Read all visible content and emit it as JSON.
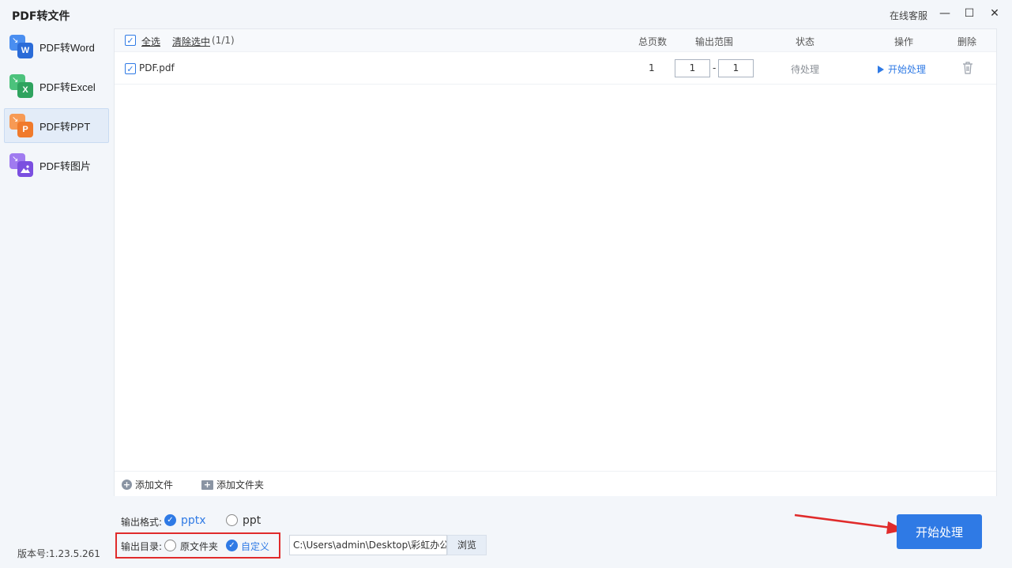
{
  "window": {
    "title": "PDF转文件",
    "service_label": "在线客服",
    "minimize_glyph": "—",
    "maximize_glyph": "☐",
    "close_glyph": "✕"
  },
  "sidebar": {
    "items": [
      {
        "label": "PDF转Word",
        "letter": "W",
        "color": "#2b6cd8",
        "icon": "word-icon",
        "active": false
      },
      {
        "label": "PDF转Excel",
        "letter": "X",
        "color": "#2fa35f",
        "icon": "excel-icon",
        "active": false
      },
      {
        "label": "PDF转PPT",
        "letter": "P",
        "color": "#f07a2b",
        "icon": "ppt-icon",
        "active": true
      },
      {
        "label": "PDF转图片",
        "letter": "",
        "color": "#7b4fe0",
        "icon": "image-icon",
        "active": false
      }
    ],
    "version": "版本号:1.23.5.261"
  },
  "table": {
    "select_all": "全选",
    "clear_selection": "清除选中",
    "selection_count": "(1/1)",
    "columns": {
      "pages": "总页数",
      "range": "输出范围",
      "status": "状态",
      "action": "操作",
      "delete": "删除"
    },
    "rows": [
      {
        "name": "PDF.pdf",
        "pages": "1",
        "range_from": "1",
        "range_sep": "-",
        "range_to": "1",
        "status": "待处理",
        "action": "开始处理",
        "checked": true
      }
    ],
    "add_file": "添加文件",
    "add_folder": "添加文件夹"
  },
  "output": {
    "format_label": "输出格式:",
    "format_options": [
      "pptx",
      "ppt"
    ],
    "format_selected": "pptx",
    "dir_label": "输出目录:",
    "dir_options": [
      "原文件夹",
      "自定义"
    ],
    "dir_selected": "自定义",
    "path": "C:\\Users\\admin\\Desktop\\彩虹办公",
    "browse_label": "浏览"
  },
  "start_button": "开始处理",
  "colors": {
    "accent": "#2f7ae5",
    "highlight_box": "#e02b2b"
  }
}
